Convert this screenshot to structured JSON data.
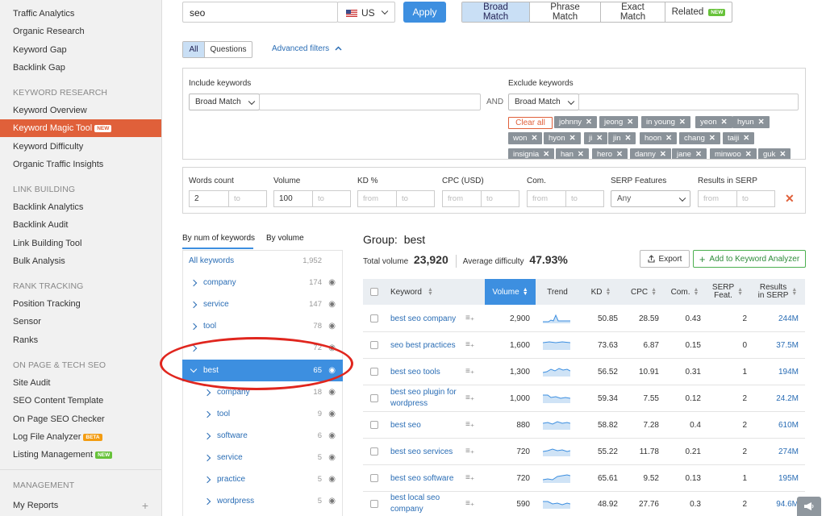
{
  "sidebar": {
    "top_items": [
      "Traffic Analytics",
      "Organic Research",
      "Keyword Gap",
      "Backlink Gap"
    ],
    "sections": [
      {
        "title": "KEYWORD RESEARCH",
        "items": [
          "Keyword Overview",
          "Keyword Magic Tool",
          "Keyword Difficulty",
          "Organic Traffic Insights"
        ]
      },
      {
        "title": "LINK BUILDING",
        "items": [
          "Backlink Analytics",
          "Backlink Audit",
          "Link Building Tool",
          "Bulk Analysis"
        ]
      },
      {
        "title": "RANK TRACKING",
        "items": [
          "Position Tracking",
          "Sensor",
          "Ranks"
        ]
      },
      {
        "title": "ON PAGE & TECH SEO",
        "items": [
          "Site Audit",
          "SEO Content Template",
          "On Page SEO Checker",
          "Log File Analyzer",
          "Listing Management"
        ]
      },
      {
        "title": "MANAGEMENT",
        "items": [
          "My Reports"
        ]
      }
    ],
    "active_item": "Keyword Magic Tool",
    "badge_new": "NEW",
    "badge_beta": "BETA",
    "add_label": "+"
  },
  "search": {
    "value": "seo",
    "country": "US",
    "apply_label": "Apply"
  },
  "match_tabs": {
    "broad": "Broad Match",
    "phrase": "Phrase Match",
    "exact": "Exact Match",
    "related": "Related",
    "related_badge": "NEW"
  },
  "filters_toggle": {
    "all": "All",
    "questions": "Questions",
    "advanced": "Advanced filters"
  },
  "include": {
    "label": "Include keywords",
    "match": "Broad Match",
    "and_label": "AND"
  },
  "exclude": {
    "label": "Exclude keywords",
    "match": "Broad Match",
    "clear_label": "Clear all",
    "tags": [
      "johnny",
      "jeong",
      "in young",
      "yeon",
      "hyun",
      "won",
      "hyon",
      "ji",
      "jin",
      "hoon",
      "chang",
      "taiji",
      "insignia",
      "han",
      "hero",
      "danny",
      "jane",
      "minwoo",
      "guk"
    ]
  },
  "range_filters": {
    "words": {
      "label": "Words count",
      "from": "2",
      "to": "to"
    },
    "volume": {
      "label": "Volume",
      "from": "100",
      "to": "to"
    },
    "kd": {
      "label": "KD %",
      "from": "from",
      "to": "to"
    },
    "cpc": {
      "label": "CPC (USD)",
      "from": "from",
      "to": "to"
    },
    "com": {
      "label": "Com.",
      "from": "from",
      "to": "to"
    },
    "serp": {
      "label": "SERP Features",
      "value": "Any"
    },
    "results": {
      "label": "Results in SERP",
      "from": "from",
      "to": "to"
    },
    "clear_icon": "✕"
  },
  "group_tabs": {
    "by_num": "By num of keywords",
    "by_volume": "By volume"
  },
  "tree": {
    "all": {
      "label": "All keywords",
      "count": "1,952"
    },
    "items": [
      {
        "label": "company",
        "count": "174"
      },
      {
        "label": "service",
        "count": "147"
      },
      {
        "label": "tool",
        "count": "78"
      },
      {
        "label": "",
        "count": "72"
      },
      {
        "label": "best",
        "count": "65"
      },
      {
        "label": "company",
        "count": "18"
      },
      {
        "label": "tool",
        "count": "9"
      },
      {
        "label": "software",
        "count": "6"
      },
      {
        "label": "service",
        "count": "5"
      },
      {
        "label": "practice",
        "count": "5"
      },
      {
        "label": "wordpress",
        "count": "5"
      }
    ]
  },
  "group": {
    "title": "Group:",
    "name": "best",
    "total_volume_label": "Total volume",
    "total_volume": "23,920",
    "avg_diff_label": "Average difficulty",
    "avg_diff": "47.93%",
    "export_label": "Export",
    "add_analyzer_label": "Add to Keyword Analyzer"
  },
  "table": {
    "headers": {
      "keyword": "Keyword",
      "volume": "Volume",
      "trend": "Trend",
      "kd": "KD",
      "cpc": "CPC",
      "com": "Com.",
      "serp_1": "SERP",
      "serp_2": "Feat.",
      "results_1": "Results",
      "results_2": "in SERP"
    },
    "rows": [
      {
        "k1": "best seo company",
        "k2": "",
        "volume": "2,900",
        "kd": "50.85",
        "cpc": "28.59",
        "com": "0.43",
        "serp": "2",
        "results": "244M"
      },
      {
        "k1": "seo best practices",
        "k2": "",
        "volume": "1,600",
        "kd": "73.63",
        "cpc": "6.87",
        "com": "0.15",
        "serp": "0",
        "results": "37.5M"
      },
      {
        "k1": "best seo tools",
        "k2": "",
        "volume": "1,300",
        "kd": "56.52",
        "cpc": "10.91",
        "com": "0.31",
        "serp": "1",
        "results": "194M"
      },
      {
        "k1": "best seo plugin for",
        "k2": "wordpress",
        "volume": "1,000",
        "kd": "59.34",
        "cpc": "7.55",
        "com": "0.12",
        "serp": "2",
        "results": "24.2M"
      },
      {
        "k1": "best seo",
        "k2": "",
        "volume": "880",
        "kd": "58.82",
        "cpc": "7.28",
        "com": "0.4",
        "serp": "2",
        "results": "610M"
      },
      {
        "k1": "best seo services",
        "k2": "",
        "volume": "720",
        "kd": "55.22",
        "cpc": "11.78",
        "com": "0.21",
        "serp": "2",
        "results": "274M"
      },
      {
        "k1": "best seo software",
        "k2": "",
        "volume": "720",
        "kd": "65.61",
        "cpc": "9.52",
        "com": "0.13",
        "serp": "1",
        "results": "195M"
      },
      {
        "k1": "best local seo",
        "k2": "company",
        "volume": "590",
        "kd": "48.92",
        "cpc": "27.76",
        "com": "0.3",
        "serp": "2",
        "results": "94.6M"
      }
    ]
  },
  "colors": {
    "accent": "#3d8fe0",
    "sidebar_active": "#e0603a",
    "annotation": "#e0261e"
  }
}
